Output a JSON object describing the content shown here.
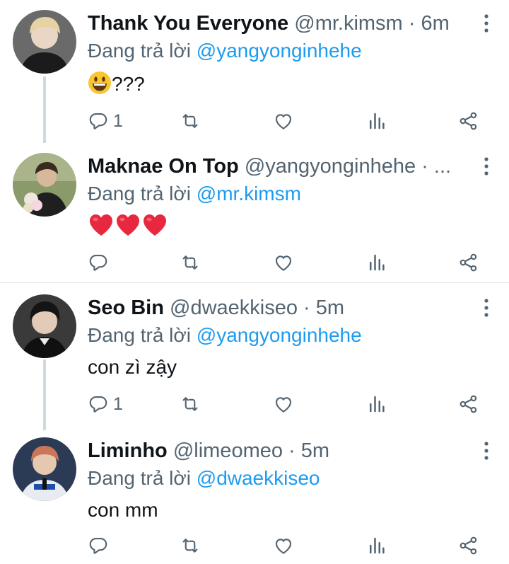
{
  "tweets": [
    {
      "name": "Thank You Everyone",
      "handle": "@mr.kimsm",
      "separator": " · ",
      "time": "6m",
      "reply_prefix": "Đang trả lời ",
      "reply_mention": "@yangyonginhehe",
      "text": "???",
      "emoji": "grinning-face",
      "reply_count": "1"
    },
    {
      "name": "Maknae On Top",
      "handle": "@yangyonginhehe",
      "separator": " · ",
      "time": "...",
      "reply_prefix": "Đang trả lời ",
      "reply_mention": "@mr.kimsm",
      "text": "",
      "emoji": "red-heart x3",
      "reply_count": ""
    },
    {
      "name": "Seo Bin",
      "handle": "@dwaekkiseo",
      "separator": " · ",
      "time": "5m",
      "reply_prefix": "Đang trả lời ",
      "reply_mention": "@yangyonginhehe",
      "text": "con zì zậy",
      "emoji": "",
      "reply_count": "1"
    },
    {
      "name": "Liminho",
      "handle": "@limeomeo",
      "separator": " · ",
      "time": "5m",
      "reply_prefix": "Đang trả lời ",
      "reply_mention": "@dwaekkiseo",
      "text": "con mm",
      "emoji": "",
      "reply_count": ""
    }
  ],
  "colors": {
    "primary_text": "#0f1419",
    "secondary_text": "#536471",
    "mention": "#1d9bf0",
    "thread_line": "#cfd9de",
    "divider": "#e3e7ea"
  },
  "icons": [
    "reply-icon",
    "retweet-icon",
    "like-icon",
    "views-icon",
    "share-icon",
    "more-icon"
  ]
}
